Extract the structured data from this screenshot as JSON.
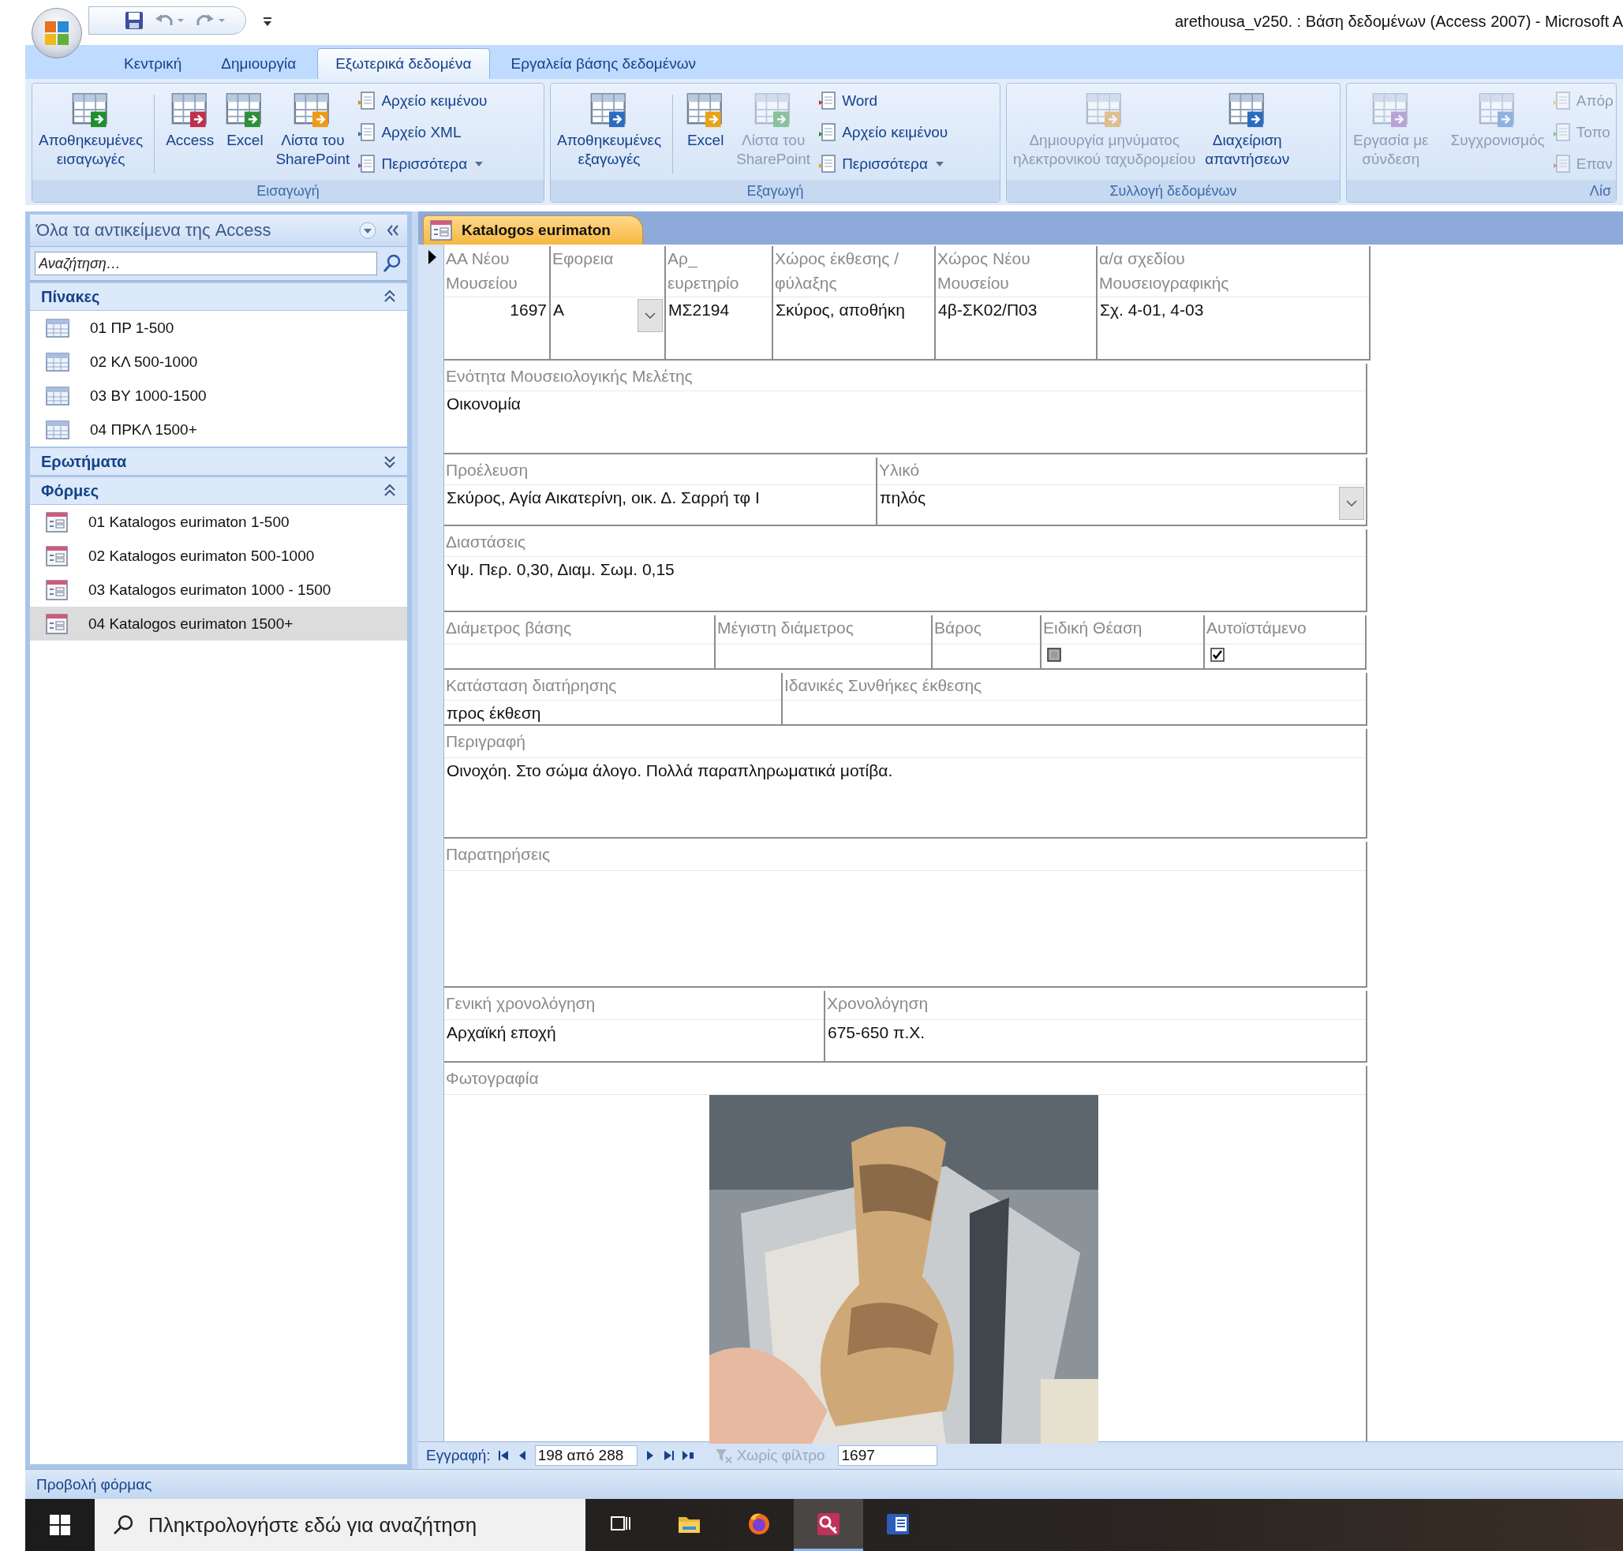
{
  "title_bar": {
    "title": "arethousa_v250. : Βάση δεδομένων (Access 2007) - Microsoft A"
  },
  "ribbon_tabs": [
    {
      "label": "Κεντρική",
      "selected": false
    },
    {
      "label": "Δημιουργία",
      "selected": false
    },
    {
      "label": "Εξωτερικά δεδομένα",
      "selected": true
    },
    {
      "label": "Εργαλεία βάσης δεδομένων",
      "selected": false
    }
  ],
  "ribbon_groups": [
    {
      "label": "Εισαγωγή",
      "items": [
        {
          "kind": "large",
          "label": "Αποθηκευμένες\nεισαγωγές",
          "disabled": false
        },
        {
          "kind": "large",
          "label": "Access",
          "disabled": false
        },
        {
          "kind": "large",
          "label": "Excel",
          "disabled": false
        },
        {
          "kind": "large",
          "label": "Λίστα του\nSharePoint",
          "disabled": false
        },
        {
          "kind": "small",
          "label": "Αρχείο κειμένου",
          "disabled": false,
          "menu": false
        },
        {
          "kind": "small",
          "label": "Αρχείο XML",
          "disabled": false,
          "menu": false
        },
        {
          "kind": "small",
          "label": "Περισσότερα",
          "disabled": false,
          "menu": true
        }
      ]
    },
    {
      "label": "Εξαγωγή",
      "items": [
        {
          "kind": "large",
          "label": "Αποθηκευμένες\nεξαγωγές",
          "disabled": false
        },
        {
          "kind": "large",
          "label": "Excel",
          "disabled": false
        },
        {
          "kind": "large",
          "label": "Λίστα του\nSharePoint",
          "disabled": true
        },
        {
          "kind": "small",
          "label": "Word",
          "disabled": false,
          "menu": false
        },
        {
          "kind": "small",
          "label": "Αρχείο κειμένου",
          "disabled": false,
          "menu": false
        },
        {
          "kind": "small",
          "label": "Περισσότερα",
          "disabled": false,
          "menu": true
        }
      ]
    },
    {
      "label": "Συλλογή δεδομένων",
      "items": [
        {
          "kind": "large",
          "label": "Δημιουργία μηνύματος\nηλεκτρονικού ταχυδρομείου",
          "disabled": true
        },
        {
          "kind": "large",
          "label": "Διαχείριση\nαπαντήσεων",
          "disabled": false
        }
      ]
    },
    {
      "label": "Λίσ",
      "items": [
        {
          "kind": "large",
          "label": "Εργασία με\nσύνδεση",
          "disabled": true
        },
        {
          "kind": "large",
          "label": "Συγχρονισμός",
          "disabled": true
        },
        {
          "kind": "small",
          "label": "Απόρ",
          "disabled": true,
          "menu": false
        },
        {
          "kind": "small",
          "label": "Τοπο",
          "disabled": true,
          "menu": false
        },
        {
          "kind": "small",
          "label": "Επαν",
          "disabled": true,
          "menu": false
        }
      ]
    }
  ],
  "nav_pane": {
    "title": "Όλα τα αντικείμενα της Access",
    "search": {
      "placeholder": "Αναζήτηση…"
    },
    "groups": [
      {
        "label": "Πίνακες",
        "expanded": true,
        "items": [
          {
            "kind": "table",
            "label": "01 ΠΡ 1-500",
            "selected": false
          },
          {
            "kind": "table",
            "label": "02 ΚΛ 500-1000",
            "selected": false
          },
          {
            "kind": "table",
            "label": "03 ΒΥ 1000-1500",
            "selected": false
          },
          {
            "kind": "table",
            "label": "04 ΠΡΚΛ 1500+",
            "selected": false
          }
        ]
      },
      {
        "label": "Ερωτήματα",
        "expanded": false
      },
      {
        "label": "Φόρμες",
        "expanded": true,
        "items": [
          {
            "kind": "form",
            "label": "01 Katalogos eurimaton 1-500",
            "selected": false
          },
          {
            "kind": "form",
            "label": "02 Katalogos eurimaton 500-1000",
            "selected": false
          },
          {
            "kind": "form",
            "label": "03 Katalogos eurimaton 1000 - 1500",
            "selected": false
          },
          {
            "kind": "form",
            "label": "04 Katalogos eurimaton 1500+",
            "selected": true
          }
        ]
      }
    ]
  },
  "form": {
    "tab": "Katalogos eurimaton",
    "rows": [
      {
        "fields": [
          {
            "kind": "number",
            "label": "ΑΑ Νέου\nΜουσείου",
            "value": "1697"
          },
          {
            "kind": "combo",
            "label": "Εφορεια",
            "value": "Α"
          },
          {
            "kind": "text",
            "label": "Αρ_\nευρετηρίο",
            "value": "ΜΣ2194"
          },
          {
            "kind": "text",
            "label": "Χώρος έκθεσης /\nφύλαξης",
            "value": "Σκύρος, αποθήκη"
          },
          {
            "kind": "text",
            "label": "Χώρος Νέου\nΜουσείου",
            "value": "4β-ΣΚ02/Π03"
          },
          {
            "kind": "text",
            "label": "α/α σχεδίου\nΜουσειογραφικής",
            "value": "Σχ. 4-01, 4-03"
          }
        ]
      },
      {
        "fields": [
          {
            "kind": "text",
            "label": "Ενότητα Μουσειολογικής Μελέτης",
            "value": "Οικονομία"
          }
        ]
      },
      {
        "fields": [
          {
            "kind": "text",
            "label": "Προέλευση",
            "value": "Σκύρος, Αγία Αικατερίνη, οικ. Δ. Σαρρή τφ Ι"
          },
          {
            "kind": "combo",
            "label": "Υλικό",
            "value": "πηλός"
          }
        ]
      },
      {
        "fields": [
          {
            "kind": "text",
            "label": "Διαστάσεις",
            "value": "Υψ. Περ. 0,30, Διαμ. Σωμ. 0,15"
          }
        ]
      },
      {
        "fields": [
          {
            "kind": "text",
            "label": "Διάμετρος βάσης"
          },
          {
            "kind": "text",
            "label": "Μέγιστη διάμετρος"
          },
          {
            "kind": "text",
            "label": "Βάρος"
          },
          {
            "kind": "checkbox",
            "label": "Ειδική Θέαση",
            "checked": false
          },
          {
            "kind": "checkbox",
            "label": "Αυτοϊστάμενο",
            "checked": true
          }
        ]
      },
      {
        "fields": [
          {
            "kind": "text",
            "label": "Κατάσταση διατήρησης",
            "value": "προς έκθεση"
          },
          {
            "kind": "text",
            "label": "Ιδανικές Συνθήκες έκθεσης"
          }
        ]
      },
      {
        "fields": [
          {
            "kind": "text",
            "label": "Περιγραφή",
            "value": "Οινοχόη. Στο σώμα άλογο. Πολλά παραπληρωματικά μοτίβα."
          }
        ]
      },
      {
        "fields": [
          {
            "kind": "text",
            "label": "Παρατηρήσεις"
          }
        ]
      },
      {
        "fields": [
          {
            "kind": "text",
            "label": "Γενική χρονολόγηση",
            "value": "Αρχαϊκή εποχή"
          },
          {
            "kind": "text",
            "label": "Χρονολόγηση",
            "value": "675-650 π.Χ."
          }
        ]
      },
      {
        "fields": [
          {
            "label": "Φωτογραφία"
          }
        ]
      }
    ]
  },
  "record_nav": {
    "label": "Εγγραφή:",
    "position": "198 από 288",
    "filter": {
      "label": "Χωρίς φίλτρο",
      "disabled": true
    },
    "search": {
      "value": "1697"
    }
  },
  "status_bar": {
    "text": "Προβολή φόρμας"
  },
  "taskbar": {
    "search": {
      "placeholder": "Πληκτρολογήστε εδώ για αναζήτηση"
    },
    "apps": [
      {
        "selected": false
      },
      {
        "selected": false
      },
      {
        "selected": false
      },
      {
        "selected": true
      },
      {
        "selected": false
      }
    ]
  }
}
